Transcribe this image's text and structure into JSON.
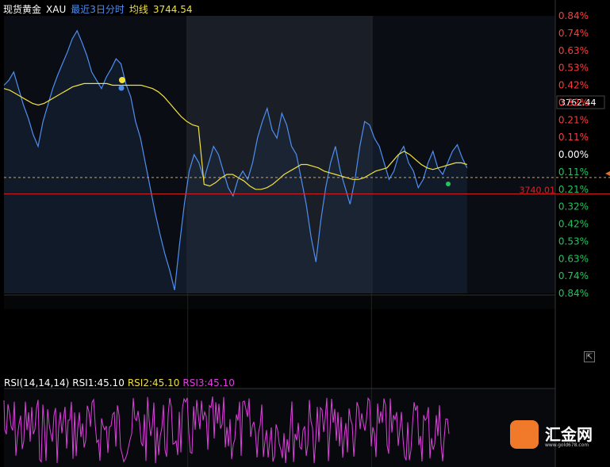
{
  "header": {
    "instrument": "现货黄金",
    "symbol": "XAU",
    "period": "最近3日分时",
    "avg_label": "均线",
    "avg_value": "3744.54"
  },
  "rsi": {
    "title": "RSI(14,14,14)",
    "rsi1": "RSI1:45.10",
    "rsi2": "RSI2:45.10",
    "rsi3": "RSI3:45.10"
  },
  "price_tag": "3762.44",
  "ref_price_label": "3740.01",
  "collapse_icon": "⇱",
  "logo": {
    "text": "汇金网",
    "url": "www.gold678.com"
  },
  "colors": {
    "up": "#ff3b3b",
    "down": "#21c55d",
    "neutral": "#ffffff",
    "price_line": "#4f8ef0",
    "avg_line": "#f0e040",
    "rsi1": "#ffffff",
    "rsi2": "#f0e040",
    "rsi3": "#e040e0",
    "brand": "#f07a2a"
  },
  "chart_data": [
    {
      "type": "line",
      "title": "现货黄金 XAU 最近3日分时",
      "y_axis_right": [
        "0.84%",
        "0.74%",
        "0.63%",
        "0.53%",
        "0.42%",
        "0.32%",
        "0.21%",
        "0.11%",
        "0.00%",
        "0.11%",
        "0.21%",
        "0.32%",
        "0.42%",
        "0.53%",
        "0.63%",
        "0.74%",
        "0.84%"
      ],
      "y_axis_sign": [
        "up",
        "up",
        "up",
        "up",
        "up",
        "up",
        "up",
        "up",
        "neutral",
        "down",
        "down",
        "down",
        "down",
        "down",
        "down",
        "down",
        "down"
      ],
      "ylim_pct": [
        -0.84,
        0.84
      ],
      "reference_price": 3740.01,
      "sessions": 3,
      "series": [
        {
          "name": "price",
          "values_pct": [
            0.42,
            0.45,
            0.5,
            0.4,
            0.3,
            0.22,
            0.12,
            0.05,
            0.2,
            0.3,
            0.4,
            0.48,
            0.55,
            0.62,
            0.7,
            0.75,
            0.68,
            0.6,
            0.5,
            0.45,
            0.4,
            0.47,
            0.52,
            0.58,
            0.55,
            0.43,
            0.35,
            0.2,
            0.1,
            -0.05,
            -0.2,
            -0.35,
            -0.48,
            -0.6,
            -0.7,
            -0.82,
            -0.55,
            -0.3,
            -0.1,
            0.0,
            -0.05,
            -0.15,
            -0.05,
            0.05,
            0.0,
            -0.1,
            -0.2,
            -0.25,
            -0.15,
            -0.1,
            -0.15,
            -0.05,
            0.1,
            0.2,
            0.28,
            0.15,
            0.1,
            0.25,
            0.18,
            0.05,
            0.0,
            -0.15,
            -0.3,
            -0.5,
            -0.65,
            -0.4,
            -0.2,
            -0.05,
            0.05,
            -0.1,
            -0.2,
            -0.3,
            -0.15,
            0.05,
            0.2,
            0.18,
            0.1,
            0.05,
            -0.05,
            -0.15,
            -0.1,
            0.0,
            0.05,
            -0.05,
            -0.1,
            -0.2,
            -0.15,
            -0.05,
            0.02,
            -0.08,
            -0.12,
            -0.05,
            0.02,
            0.06,
            -0.02,
            -0.08
          ],
          "color": "#4f8ef0"
        },
        {
          "name": "均线",
          "values_pct": [
            0.4,
            0.39,
            0.37,
            0.35,
            0.33,
            0.31,
            0.3,
            0.31,
            0.33,
            0.35,
            0.37,
            0.39,
            0.41,
            0.42,
            0.43,
            0.43,
            0.43,
            0.43,
            0.43,
            0.42,
            0.42,
            0.42,
            0.42,
            0.42,
            0.42,
            0.41,
            0.4,
            0.38,
            0.35,
            0.31,
            0.27,
            0.23,
            0.2,
            0.18,
            0.17,
            -0.18,
            -0.19,
            -0.17,
            -0.14,
            -0.12,
            -0.12,
            -0.14,
            -0.16,
            -0.19,
            -0.21,
            -0.21,
            -0.2,
            -0.18,
            -0.15,
            -0.12,
            -0.1,
            -0.08,
            -0.06,
            -0.06,
            -0.07,
            -0.08,
            -0.1,
            -0.11,
            -0.12,
            -0.13,
            -0.14,
            -0.15,
            -0.15,
            -0.14,
            -0.12,
            -0.1,
            -0.09,
            -0.08,
            -0.04,
            0.0,
            0.02,
            0.0,
            -0.03,
            -0.06,
            -0.08,
            -0.09,
            -0.08,
            -0.07,
            -0.06,
            -0.05,
            -0.05,
            -0.06
          ],
          "color": "#f0e040"
        }
      ]
    },
    {
      "type": "line",
      "title": "RSI(14,14,14)",
      "series": [
        {
          "name": "RSI1",
          "last": 45.1
        },
        {
          "name": "RSI2",
          "last": 45.1
        },
        {
          "name": "RSI3",
          "last": 45.1
        }
      ]
    }
  ]
}
